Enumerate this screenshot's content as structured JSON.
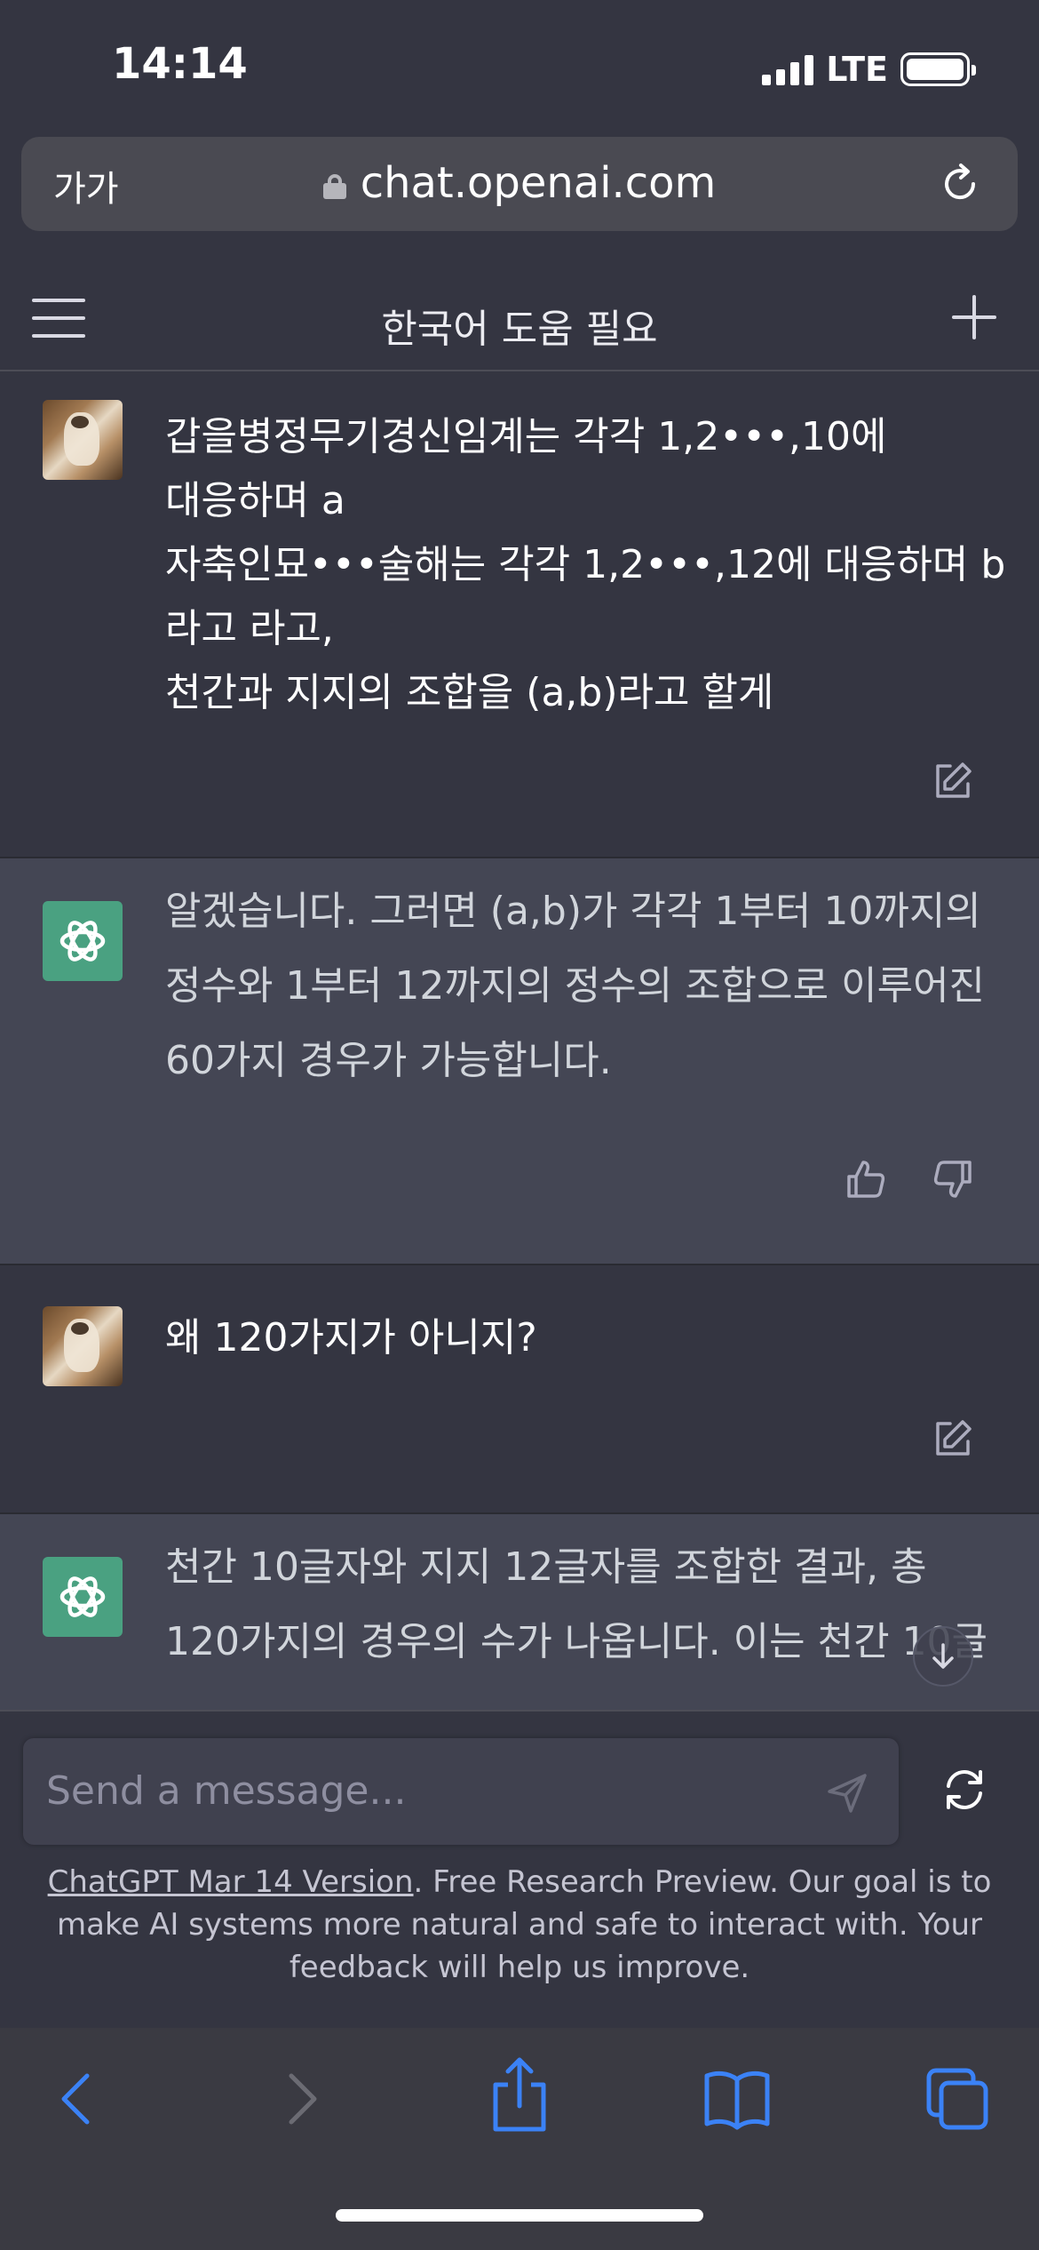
{
  "status_bar": {
    "time": "14:14",
    "network": "LTE",
    "battery_level": 0.85
  },
  "browser": {
    "text_size_button": "가가",
    "url": "chat.openai.com"
  },
  "header": {
    "title": "한국어 도움 필요"
  },
  "messages": [
    {
      "role": "user",
      "lines": [
        "갑을병정무기경신임계는 각각 1,2•••,10에",
        "대응하며 a",
        "자축인묘•••술해는 각각 1,2•••,12에 대응하며 b",
        "라고 라고,",
        "천간과 지지의 조합을 (a,b)라고 할게"
      ]
    },
    {
      "role": "assistant",
      "lines": [
        "알겠습니다. 그러면 (a,b)가 각각 1부터 10까지의",
        "정수와 1부터 12까지의 정수의 조합으로 이루어진",
        "60가지 경우가 가능합니다."
      ]
    },
    {
      "role": "user",
      "lines": [
        "왜 120가지가 아니지?"
      ]
    },
    {
      "role": "assistant",
      "lines": [
        "천간 10글자와 지지 12글자를 조합한 결과, 총",
        "120가지의 경우의 수가 나옵니다. 이는 천간 10글"
      ]
    }
  ],
  "composer": {
    "placeholder": "Send a message..."
  },
  "footer": {
    "version_link": "ChatGPT Mar 14 Version",
    "note": ". Free Research Preview. Our goal is to make AI systems more natural and safe to interact with. Your feedback will help us improve."
  },
  "colors": {
    "accent_green": "#4aa181",
    "background": "#343541",
    "assistant_bg": "#444654",
    "safari_blue": "#3b82f6"
  },
  "icons": {
    "user_actions": [
      "edit-icon"
    ],
    "assistant_actions": [
      "thumbs-up-icon",
      "thumbs-down-icon"
    ],
    "toolbar": [
      "back-icon",
      "forward-icon",
      "share-icon",
      "bookmarks-icon",
      "tabs-icon"
    ]
  }
}
